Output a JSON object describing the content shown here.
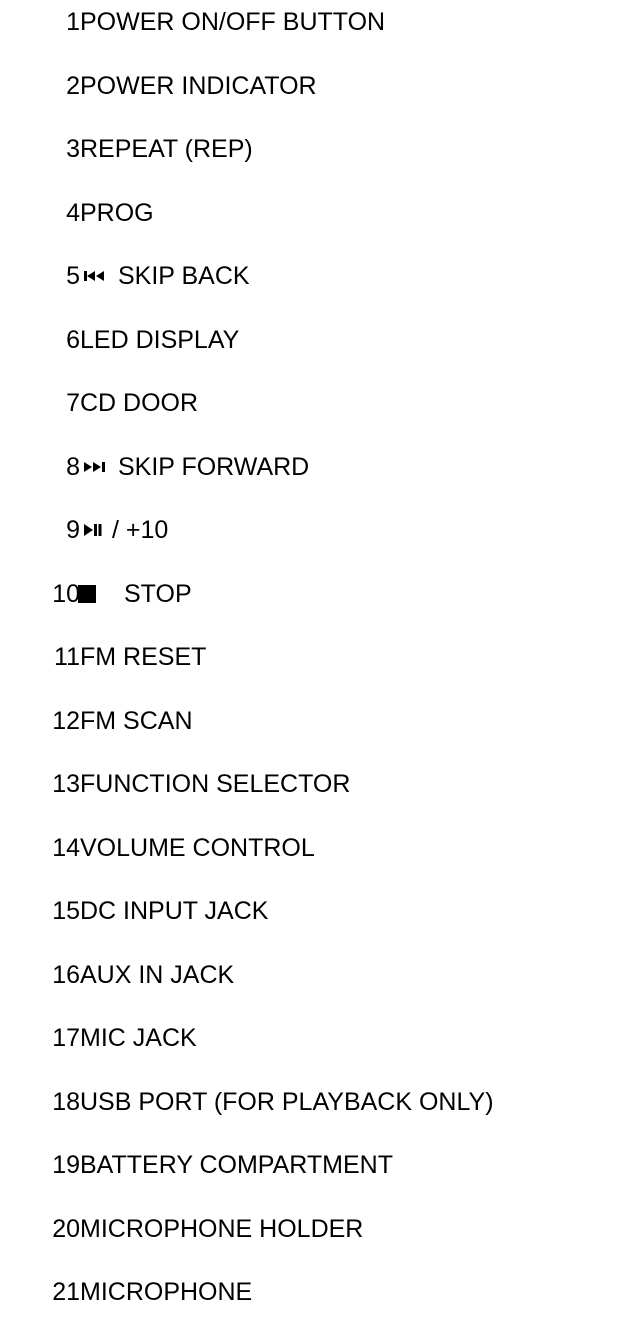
{
  "parts": [
    {
      "num": "1",
      "label": "POWER ON/OFF BUTTON"
    },
    {
      "num": "2",
      "label": "POWER INDICATOR"
    },
    {
      "num": "3",
      "label": "REPEAT (REP)"
    },
    {
      "num": "4",
      "label": "PROG"
    },
    {
      "num": "5",
      "label": "SKIP BACK",
      "icon": "skip-back-icon"
    },
    {
      "num": "6",
      "label": "LED DISPLAY"
    },
    {
      "num": "7",
      "label": "CD DOOR"
    },
    {
      "num": "8",
      "label": "SKIP FORWARD",
      "icon": "skip-forward-icon"
    },
    {
      "num": "9",
      "label": "/ +10",
      "icon": "play-pause-icon"
    },
    {
      "num": "10",
      "label": "STOP",
      "icon": "stop-icon"
    },
    {
      "num": "11",
      "label": "FM RESET"
    },
    {
      "num": "12",
      "label": "FM SCAN"
    },
    {
      "num": "13",
      "label": "FUNCTION SELECTOR"
    },
    {
      "num": "14",
      "label": "VOLUME CONTROL"
    },
    {
      "num": "15",
      "label": "DC INPUT JACK"
    },
    {
      "num": "16",
      "label": "AUX IN JACK"
    },
    {
      "num": "17",
      "label": "MIC JACK"
    },
    {
      "num": "18",
      "label": "USB PORT (FOR PLAYBACK ONLY)"
    },
    {
      "num": "19",
      "label": "BATTERY COMPARTMENT"
    },
    {
      "num": "20",
      "label": "MICROPHONE HOLDER"
    },
    {
      "num": "21",
      "label": "MICROPHONE"
    }
  ]
}
